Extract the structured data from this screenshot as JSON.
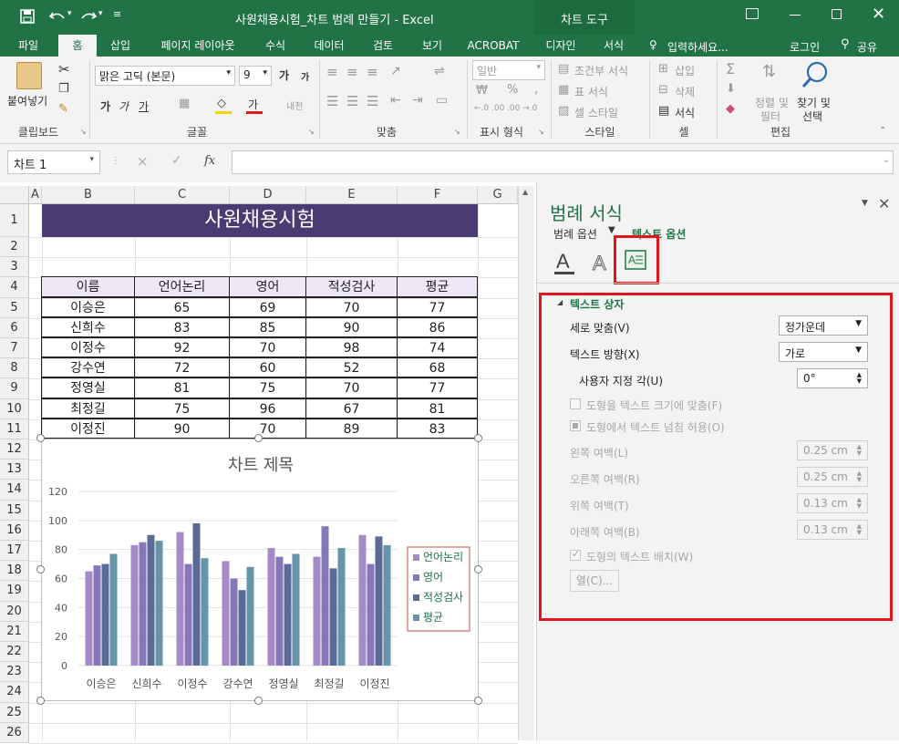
{
  "titlebar": {
    "title": "사원채용시험_차트 범례 만들기 - Excel",
    "chart_tools": "차트 도구"
  },
  "tabs": [
    "파일",
    "홈",
    "삽입",
    "페이지 레이아웃",
    "수식",
    "데이터",
    "검토",
    "보기",
    "ACROBAT",
    "디자인",
    "서식"
  ],
  "tell_me": "입력하세요...",
  "login": "로그인",
  "share": "공유",
  "ribbon": {
    "paste": "붙여넣기",
    "clipboard": "클립보드",
    "font_name": "맑은 고딕 (본문)",
    "font_size": "9",
    "font_group": "글꼴",
    "align_group": "맞춤",
    "number_format": "일반",
    "number_group": "표시 형식",
    "cond_format": "조건부 서식",
    "table_format": "표 서식",
    "cell_style": "셀 스타일",
    "style_group": "스타일",
    "insert": "삽입",
    "delete": "삭제",
    "format": "서식",
    "cells_group": "셀",
    "sort": "정렬 및",
    "filter": "필터",
    "find": "찾기 및",
    "select": "선택",
    "edit_group": "편집",
    "font_a": "가",
    "font_b": "가",
    "font_u": "가",
    "font_color": "가",
    "increase_font": "가",
    "decrease_font": "가",
    "wrap": "내천",
    "percent": "%",
    "comma": ",",
    "dec_inc": "←.0 .00",
    "dec_dec": ".00 →.0"
  },
  "formula": {
    "namebox": "차트 1",
    "cancel": "×",
    "enter": "✓",
    "fx": "fx"
  },
  "sheet": {
    "columns": [
      "A",
      "B",
      "C",
      "D",
      "E",
      "F",
      "G"
    ],
    "rows": [
      "1",
      "2",
      "3",
      "4",
      "5",
      "6",
      "7",
      "8",
      "9",
      "10",
      "11",
      "12",
      "13",
      "14",
      "15",
      "16",
      "17",
      "18",
      "19",
      "20",
      "21",
      "22",
      "23",
      "24",
      "25",
      "26"
    ],
    "title": "사원채용시험",
    "headers": [
      "이름",
      "언어논리",
      "영어",
      "적성검사",
      "평균"
    ],
    "data": [
      [
        "이승은",
        "65",
        "69",
        "70",
        "77"
      ],
      [
        "신희수",
        "83",
        "85",
        "90",
        "86"
      ],
      [
        "이정수",
        "92",
        "70",
        "98",
        "74"
      ],
      [
        "강수연",
        "72",
        "60",
        "52",
        "68"
      ],
      [
        "정영실",
        "81",
        "75",
        "70",
        "77"
      ],
      [
        "최정길",
        "75",
        "96",
        "67",
        "81"
      ],
      [
        "이정진",
        "90",
        "70",
        "89",
        "83"
      ]
    ]
  },
  "chart_data": {
    "type": "bar",
    "title": "차트 제목",
    "categories": [
      "이승은",
      "신희수",
      "이정수",
      "강수연",
      "정영실",
      "최정길",
      "이정진"
    ],
    "series": [
      {
        "name": "언어논리",
        "values": [
          65,
          83,
          92,
          72,
          81,
          75,
          90
        ],
        "color": "#a48bc6"
      },
      {
        "name": "영어",
        "values": [
          69,
          85,
          70,
          60,
          75,
          96,
          70
        ],
        "color": "#8577b8"
      },
      {
        "name": "적성검사",
        "values": [
          70,
          90,
          98,
          52,
          70,
          67,
          89
        ],
        "color": "#5b6b96"
      },
      {
        "name": "평균",
        "values": [
          77,
          86,
          74,
          68,
          77,
          81,
          83
        ],
        "color": "#6495ab"
      }
    ],
    "yticks": [
      "0",
      "20",
      "40",
      "60",
      "80",
      "100",
      "120"
    ],
    "ylim": [
      0,
      120
    ],
    "legend_position": "right",
    "grid": true
  },
  "pane": {
    "title": "범례 서식",
    "option_legend": "범례 옵션",
    "option_text": "텍스트 옵션",
    "section": "텍스트 상자",
    "valign_label": "세로 맞춤(V)",
    "valign_value": "정가운데",
    "direction_label": "텍스트 방향(X)",
    "direction_value": "가로",
    "angle_label": "사용자 지정 각(U)",
    "angle_value": "0°",
    "resize_label": "도형을 텍스트 크기에 맞춤(F)",
    "overflow_label": "도형에서 텍스트 넘침 허용(O)",
    "left_label": "왼쪽 여백(L)",
    "left_value": "0.25 cm",
    "right_label": "오른쪽 여백(R)",
    "right_value": "0.25 cm",
    "top_label": "위쪽 여백(T)",
    "top_value": "0.13 cm",
    "bottom_label": "아래쪽 여백(B)",
    "bottom_value": "0.13 cm",
    "wrap_label": "도형의 텍스트 배치(W)",
    "columns_button": "열(C)...",
    "highlight_color": "#e0151d"
  }
}
